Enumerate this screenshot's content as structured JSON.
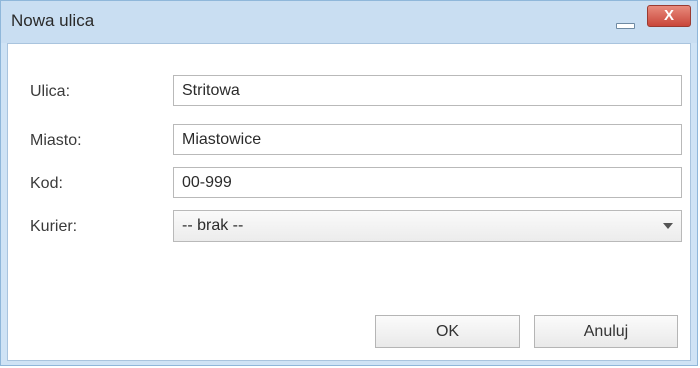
{
  "window": {
    "title": "Nowa ulica",
    "close_label": "X"
  },
  "form": {
    "fields": [
      {
        "label": "Ulica:",
        "value": "Stritowa"
      },
      {
        "label": "Miasto:",
        "value": "Miastowice"
      },
      {
        "label": "Kod:",
        "value": "00-999"
      }
    ],
    "courier": {
      "label": "Kurier:",
      "selected": "-- brak --"
    }
  },
  "buttons": {
    "ok": "OK",
    "cancel": "Anuluj"
  },
  "icons": {
    "minimize": "minimize-icon",
    "close": "close-icon",
    "dropdown": "chevron-down-icon"
  },
  "colors": {
    "titlebar": "#c9def2",
    "close_button": "#c9463a",
    "border": "#8fb7da"
  }
}
